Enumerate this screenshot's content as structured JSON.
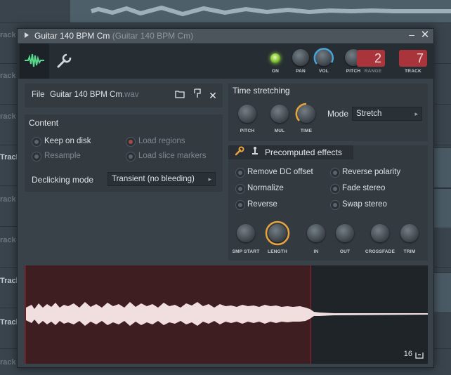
{
  "background": {
    "track_labels": [
      "rack",
      "rack",
      "rack",
      "Track",
      "rack",
      "rack",
      "Track",
      "Track",
      "rack"
    ]
  },
  "window": {
    "title": "Guitar 140 BPM Cm",
    "title_sub": "(Guitar 140 BPM Cm)",
    "minimize": "–",
    "close": "✕"
  },
  "toolbar": {
    "tabs": [
      {
        "name": "waveform-tab",
        "icon": "waveform-icon",
        "active": true
      },
      {
        "name": "wrench-tab",
        "icon": "wrench-icon",
        "active": false
      }
    ],
    "controls": {
      "on_label": "ON",
      "pan_label": "PAN",
      "vol_label": "VOL",
      "pitch_label": "PITCH",
      "range_label": "RANGE",
      "range_value": "2",
      "track_label": "TRACK",
      "track_value": "7"
    }
  },
  "file": {
    "label": "File",
    "name": "Guitar 140 BPM Cm",
    "ext": ".wav"
  },
  "content": {
    "title": "Content",
    "options": [
      {
        "label": "Keep on disk",
        "enabled": true
      },
      {
        "label": "Load regions",
        "enabled": false
      },
      {
        "label": "Resample",
        "enabled": false
      },
      {
        "label": "Load slice markers",
        "enabled": false
      }
    ],
    "declicking_label": "Declicking mode",
    "declicking_value": "Transient (no bleeding)"
  },
  "time_stretching": {
    "title": "Time stretching",
    "knobs": [
      "PITCH",
      "MUL",
      "TIME"
    ],
    "mode_label": "Mode",
    "mode_value": "Stretch"
  },
  "precomputed": {
    "title": "Precomputed effects",
    "options_left": [
      "Remove DC offset",
      "Normalize",
      "Reverse"
    ],
    "options_right": [
      "Reverse polarity",
      "Fade stereo",
      "Swap stereo"
    ],
    "knobs": [
      "SMP START",
      "LENGTH",
      "IN",
      "OUT",
      "CROSSFADE",
      "TRIM"
    ]
  },
  "waveform": {
    "zoom_number": "16"
  },
  "colors": {
    "accent_blue": "#4aa3d8",
    "accent_orange": "#e8a43a",
    "led_green": "#8fd13a",
    "digit_red": "#a9343c",
    "wave_selection": "#3e1e20",
    "wave_color": "#f1dede"
  }
}
